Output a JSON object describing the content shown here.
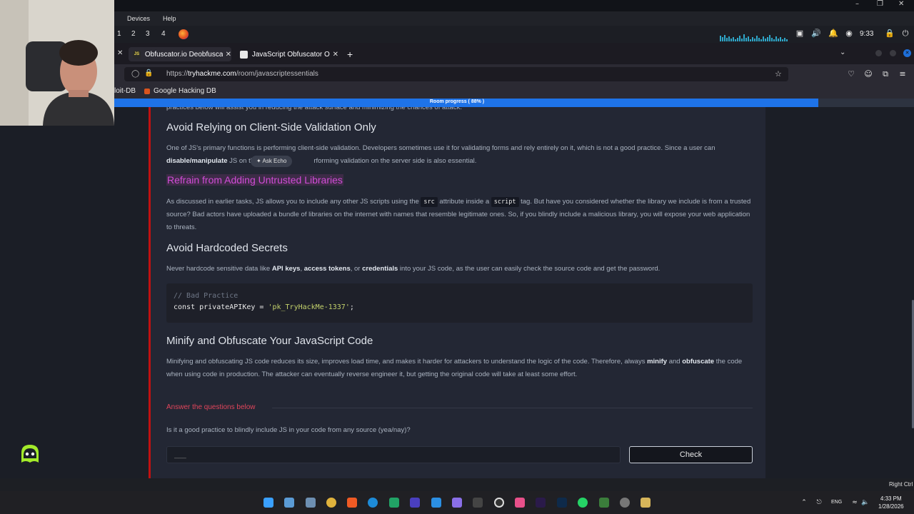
{
  "guest_menu": [
    "Devices",
    "Help"
  ],
  "workspaces": [
    "1",
    "2",
    "3",
    "4"
  ],
  "panel": {
    "clock": "9:33"
  },
  "tabs": [
    {
      "title": "Obfuscator.io Deobfuscat",
      "icon_text": "JS",
      "icon": "js-icon"
    },
    {
      "title": "JavaScript Obfuscator Or",
      "icon_text": "",
      "icon": "page-icon"
    }
  ],
  "url": {
    "prefix": "https://",
    "host": "tryhackme.com",
    "path": "/room/javascriptessentials"
  },
  "bookmarks": [
    "loit-DB",
    "Google Hacking DB"
  ],
  "progress": {
    "label": "Room progress ( 88% )",
    "percent": 88
  },
  "content": {
    "cut_text": "practices below will assist you in reducing the attack surface and minimizing the chances of attack.",
    "s1_title": "Avoid Relying on Client-Side Validation Only",
    "s1_line1": "One of JS's primary functions is performing client-side validation. Developers sometimes use it for validating forms and rely entirely on it, which is not a good practice. Since a user can",
    "s1_bold": "disable/manipulate",
    "s1_line2_a": " JS on the",
    "s1_line2_b": "rforming validation on the server side is also essential.",
    "ask_echo": "Ask Echo",
    "s2_title": "Refrain from Adding Untrusted Libraries",
    "s2_a": "As discussed in earlier tasks, JS allows you to include any other JS scripts using the ",
    "s2_code1": "src",
    "s2_b": " attribute inside a ",
    "s2_code2": "script",
    "s2_c": " tag. But have you considered whether the library we include is from a trusted source? Bad actors have uploaded a bundle of libraries on the internet with names that resemble legitimate ones. So, if you blindly include a malicious library, you will expose your web application to threats.",
    "s3_title": "Avoid Hardcoded Secrets",
    "s3_a": "Never hardcode sensitive data like ",
    "s3_b1": "API keys",
    "s3_sep1": ", ",
    "s3_b2": "access tokens",
    "s3_sep2": ", or ",
    "s3_b3": "credentials",
    "s3_c": " into your JS code, as the user can easily check the source code and get the password.",
    "code_comment": "// Bad Practice",
    "code_a": "const privateAPIKey = ",
    "code_str": "'pk_TryHackMe-1337'",
    "code_end": ";",
    "s4_title": "Minify and Obfuscate Your JavaScript Code",
    "s4_a": "Minifying and obfuscating JS code reduces its size, improves load time, and makes it harder for attackers to understand the logic of the code. Therefore, always ",
    "s4_b1": "minify",
    "s4_and": " and ",
    "s4_b2": "obfuscate",
    "s4_c": " the code when using code in production. The attacker can eventually reverse engineer it, but getting the original code will take at least some effort.",
    "answer_label": "Answer the questions below",
    "question": "Is it a good practice to blindly include JS in your code from any source (yea/nay)?",
    "answer_placeholder": "___",
    "check": "Check"
  },
  "taskbar": {
    "lang": "ENG",
    "time": "4:33 PM",
    "date": "1/28/2026",
    "right_ctrl": "Right Ctrl"
  },
  "colors": {
    "accent": "#1e73e8",
    "card_border": "#c11111",
    "highlight": "#d14cd7",
    "answer": "#e0455b"
  }
}
